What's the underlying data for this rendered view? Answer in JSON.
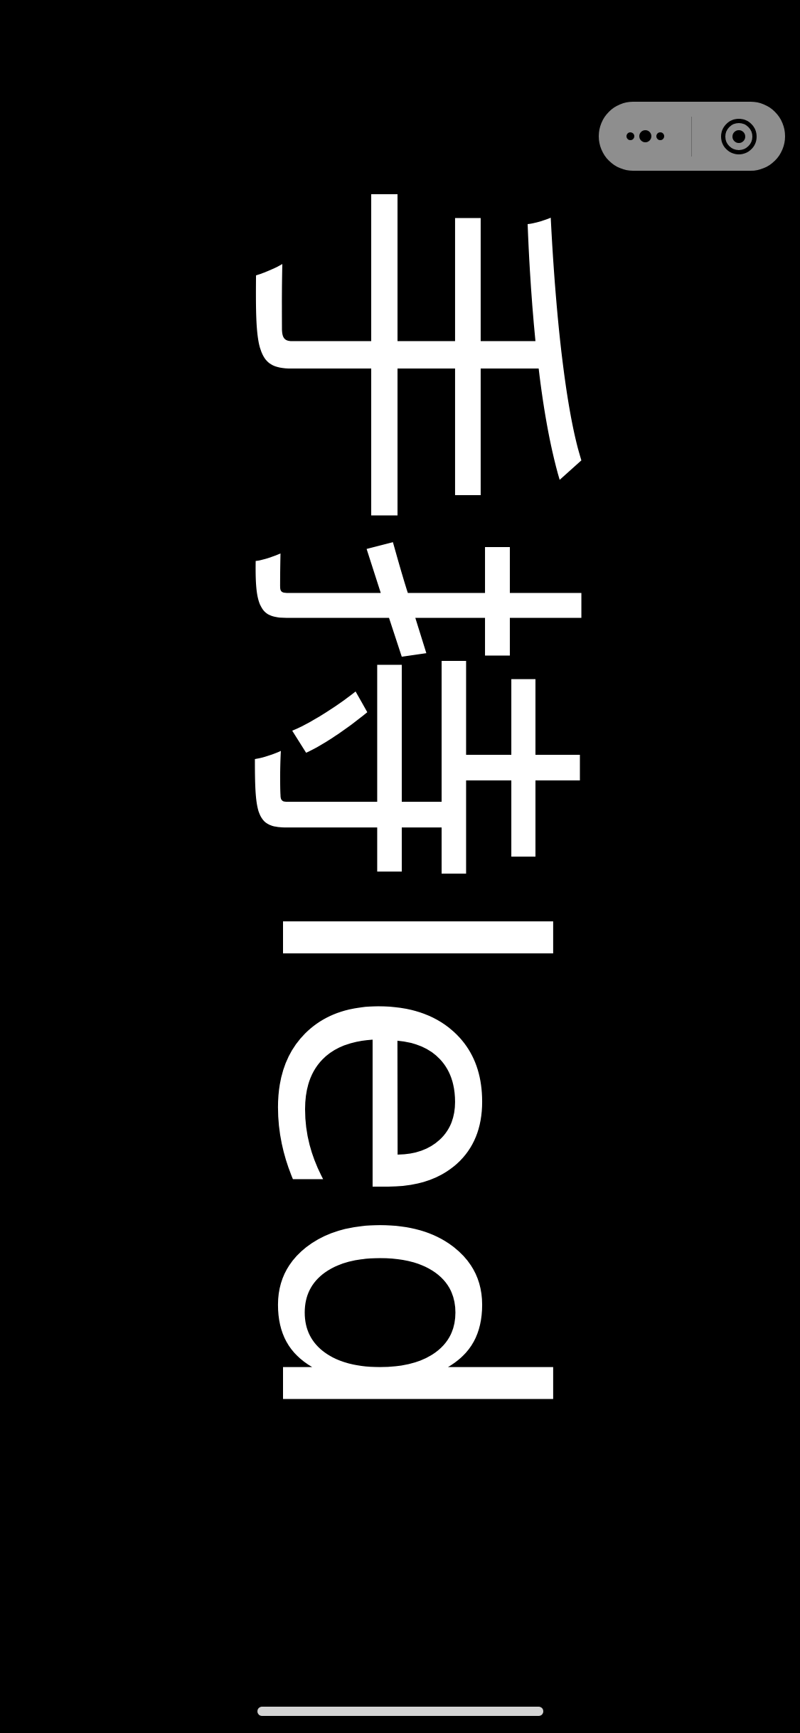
{
  "barrage": {
    "text": "手持led"
  },
  "capsule": {
    "more_icon": "more-dots-icon",
    "close_icon": "circle-target-icon",
    "background_color": "#8e8e8e"
  },
  "colors": {
    "background": "#000000",
    "text": "#ffffff",
    "home_indicator": "#d4d4d4"
  }
}
